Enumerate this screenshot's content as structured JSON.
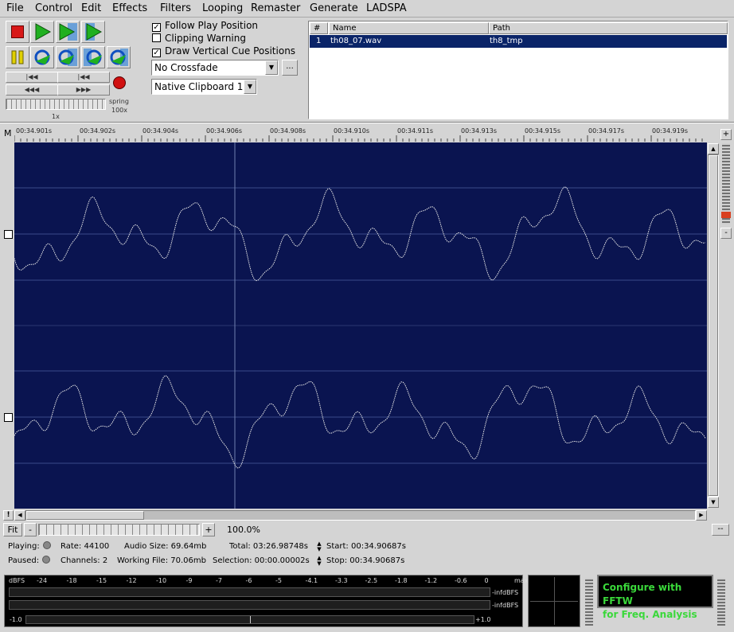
{
  "menu": [
    "File",
    "Control",
    "Edit",
    "Effects",
    "Filters",
    "Looping",
    "Remaster",
    "Generate",
    "LADSPA"
  ],
  "transport": {
    "rate_label": "1x",
    "spring_label": "spring",
    "spring_value": "100x"
  },
  "options": {
    "follow_play": {
      "label": "Follow Play Position",
      "checked": "✓"
    },
    "clipping": {
      "label": "Clipping Warning",
      "checked": ""
    },
    "draw_cues": {
      "label": "Draw Vertical Cue Positions",
      "checked": "✓"
    },
    "crossfade": "No Crossfade",
    "crossfade_more": "...",
    "clipboard": "Native Clipboard 1"
  },
  "files": {
    "headers": {
      "num": "#",
      "name": "Name",
      "path": "Path"
    },
    "rows": [
      {
        "num": "1",
        "name": "th08_07.wav",
        "path": "th8_tmp"
      }
    ]
  },
  "ruler": {
    "marker": "M",
    "ticks": [
      "00:34.901s",
      "00:34.902s",
      "00:34.904s",
      "00:34.906s",
      "00:34.908s",
      "00:34.910s",
      "00:34.911s",
      "00:34.913s",
      "00:34.915s",
      "00:34.917s",
      "00:34.919s"
    ]
  },
  "zoom": {
    "fit": "Fit",
    "minus": "-",
    "plus": "+",
    "value": "100.0%",
    "dashes": "--"
  },
  "status": {
    "playing": "Playing:",
    "paused": "Paused:",
    "rate": "Rate: 44100",
    "channels": "Channels: 2",
    "audio_size": "Audio Size: 69.64mb",
    "working_file": "Working File: 70.06mb",
    "total": "Total:  03:26.98748s",
    "selection": "Selection: 00:00.00002s",
    "start": "Start:  00:34.90687s",
    "stop": "Stop:  00:34.90687s"
  },
  "meter": {
    "dbfs": "dBFS",
    "scale": [
      "-24",
      "-18",
      "-15",
      "-12",
      "-10",
      "-9",
      "-7",
      "-6",
      "-5",
      "-4.1",
      "-3.3",
      "-2.5",
      "-1.8",
      "-1.2",
      "-0.6",
      "0",
      "max"
    ],
    "left_peak": "-infdBFS",
    "right_peak": "-infdBFS",
    "balance_min": "-1.0",
    "balance_max": "+1.0"
  },
  "fftw": {
    "line1": "Configure with FFTW",
    "line2": "for Freq. Analysis"
  },
  "colors": {
    "wave_bg": "#0a1450",
    "wave_line": "#e8e8e8",
    "selection": "#0a2468",
    "fftw_text": "#3ad83a"
  }
}
